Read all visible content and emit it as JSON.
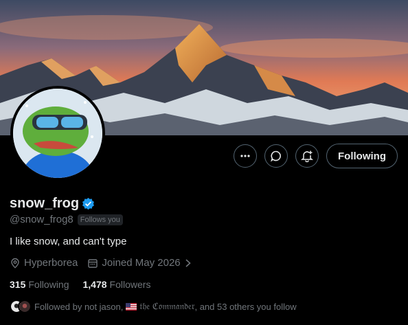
{
  "profile": {
    "display_name": "snow_frog",
    "handle": "@snow_frog8",
    "follows_you": "Follows you",
    "bio": "I like snow, and can't type",
    "location": "Hyperborea",
    "joined": "Joined May 2026",
    "following_count": "315",
    "following_label": "Following",
    "followers_count": "1,478",
    "followers_label": "Followers",
    "followed_by_prefix": "Followed by not jason,",
    "followed_by_name2": "𝔱𝔥𝔢 ℭ𝔬𝔪𝔪𝔞𝔫𝔡𝔢𝔯 ",
    "followed_by_suffix": ", and 53 others you follow"
  },
  "actions": {
    "more_icon": "more-icon",
    "message_icon": "message-icon",
    "notify_icon": "bell-plus-icon",
    "follow_label": "Following"
  },
  "colors": {
    "verified": "#1d9bf0",
    "background": "#000000",
    "text": "#e7e9ea",
    "muted": "#71767b"
  }
}
